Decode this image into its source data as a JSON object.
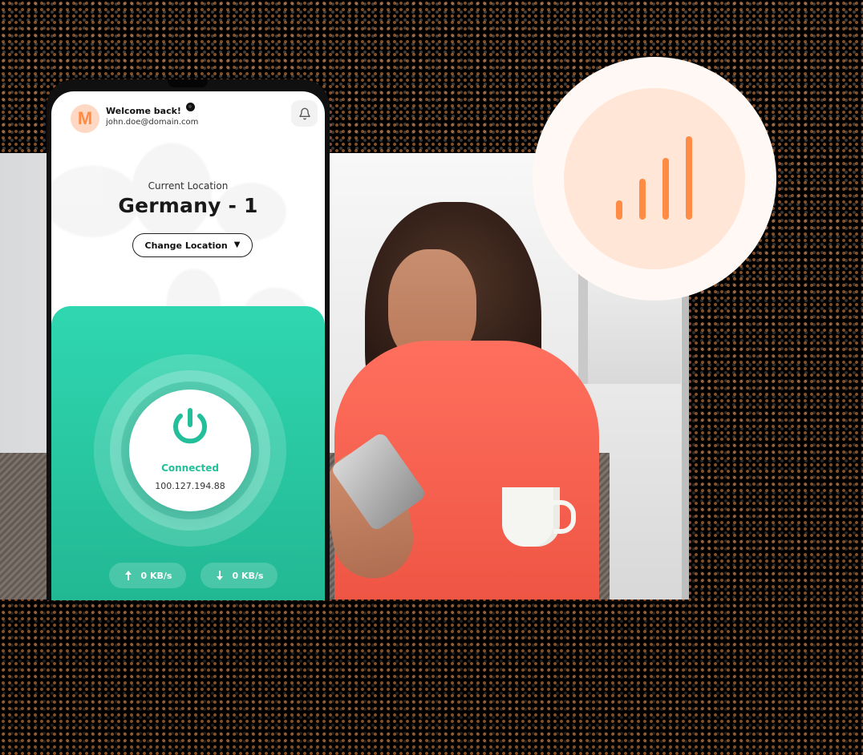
{
  "user": {
    "avatar_initial": "M",
    "welcome": "Welcome back!",
    "email": "john.doe@domain.com"
  },
  "location": {
    "label": "Current Location",
    "title": "Germany - 1",
    "button_label": "Change Location"
  },
  "connection": {
    "status": "Connected",
    "ip": "100.127.194.88",
    "upload": "0 KB/s",
    "download": "0 KB/s"
  },
  "colors": {
    "accent_green": "#2fd7b0",
    "accent_orange": "#ff8b45",
    "signal_bg": "#ffe6d7"
  },
  "icons": {
    "notification": "bell-icon",
    "power": "power-icon",
    "upload": "upload-icon",
    "download": "download-icon",
    "signal": "signal-strength-icon"
  }
}
